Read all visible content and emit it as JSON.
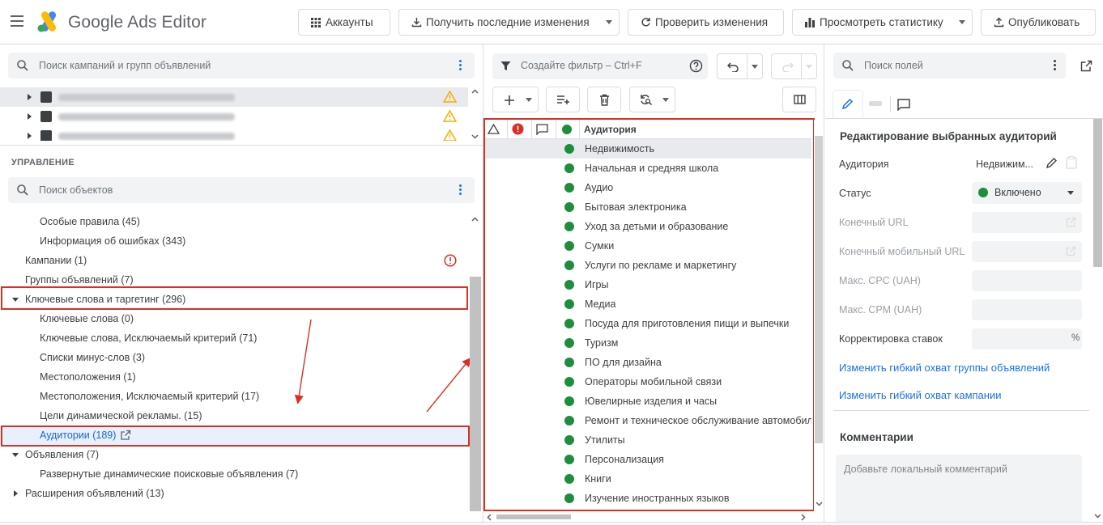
{
  "app": {
    "title": "Google Ads Editor"
  },
  "toolbar": {
    "accounts": "Аккаунты",
    "get_changes": "Получить последние изменения",
    "check_changes": "Проверить изменения",
    "view_stats": "Просмотреть статистику",
    "publish": "Опубликовать"
  },
  "left": {
    "campaign_search_placeholder": "Поиск кампаний и групп объявлений",
    "section_title": "УПРАВЛЕНИЕ",
    "object_search_placeholder": "Поиск объектов",
    "tree": [
      {
        "label": "Особые правила (45)"
      },
      {
        "label": "Информация об ошибках (343)"
      },
      {
        "label": "Кампании (1)"
      },
      {
        "label": "Группы объявлений (7)"
      },
      {
        "label": "Ключевые слова и таргетинг (296)"
      },
      {
        "label": "Ключевые слова (0)"
      },
      {
        "label": "Ключевые слова, Исключаемый критерий (71)"
      },
      {
        "label": "Списки минус-слов (3)"
      },
      {
        "label": "Местоположения (1)"
      },
      {
        "label": "Местоположения, Исключаемый критерий (17)"
      },
      {
        "label": "Цели динамической рекламы. (15)"
      },
      {
        "label": "Аудитории (189)"
      },
      {
        "label": "Объявления (7)"
      },
      {
        "label": "Развернутые динамические поисковые объявления (7)"
      },
      {
        "label": "Расширения объявлений (13)"
      }
    ]
  },
  "middle": {
    "filter_placeholder": "Создайте фильтр – Ctrl+F",
    "column_header": "Аудитория",
    "rows": [
      "Недвижимость",
      "Начальная и средняя школа",
      "Аудио",
      "Бытовая электроника",
      "Уход за детьми и образование",
      "Сумки",
      "Услуги по рекламе и маркетингу",
      "Игры",
      "Медиа",
      "Посуда для приготовления пищи и выпечки",
      "Туризм",
      "ПО для дизайна",
      "Операторы мобильной связи",
      "Ювелирные изделия и часы",
      "Ремонт и техническое обслуживание автомобилей",
      "Утилиты",
      "Персонализация",
      "Книги",
      "Изучение иностранных языков"
    ]
  },
  "right": {
    "field_search_placeholder": "Поиск полей",
    "edit_title": "Редактирование выбранных аудиторий",
    "audience_label": "Аудитория",
    "audience_value": "Недвижим...",
    "status_label": "Статус",
    "status_value": "Включено",
    "final_url_label": "Конечный URL",
    "final_mobile_url_label": "Конечный мобильный URL",
    "max_cpc_label": "Макс. CPC (UAH)",
    "max_cpm_label": "Макс. CPM (UAH)",
    "bid_adj_label": "Корректировка ставок",
    "bid_adj_unit": "%",
    "link_adgroup": "Изменить гибкий охват группы объявлений",
    "link_campaign": "Изменить гибкий охват кампании",
    "comments_title": "Комментарии",
    "comment_placeholder": "Добавьте локальный комментарий"
  },
  "colors": {
    "accent": "#1a73e8",
    "enabled": "#1e8e3e",
    "error": "#d93025",
    "warning": "#f9ab00"
  }
}
